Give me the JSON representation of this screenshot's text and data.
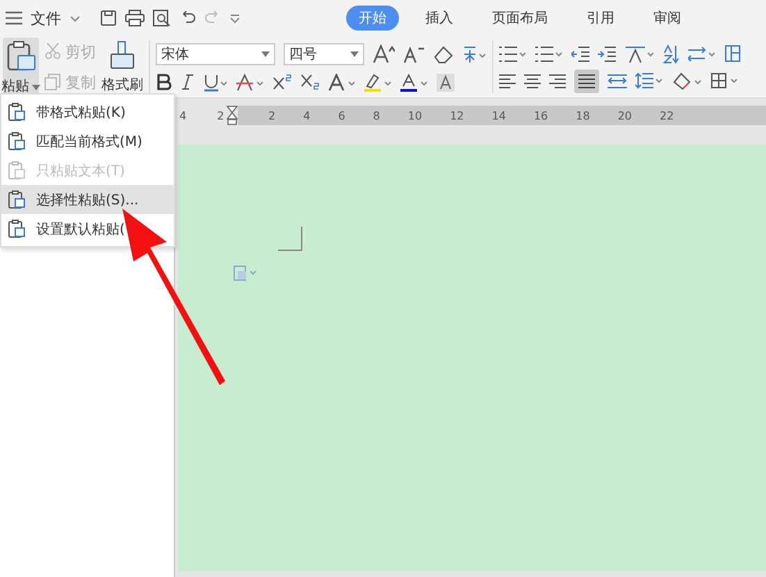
{
  "menu_bar": {
    "file_label": "文件",
    "tabs": [
      {
        "label": "开始",
        "selected": true
      },
      {
        "label": "插入",
        "selected": false
      },
      {
        "label": "页面布局",
        "selected": false
      },
      {
        "label": "引用",
        "selected": false
      },
      {
        "label": "审阅",
        "selected": false
      }
    ]
  },
  "toolbar": {
    "paste_label": "粘贴",
    "cut_label": "剪切",
    "copy_label": "复制",
    "format_painter_label": "格式刷",
    "font_name": "宋体",
    "font_size": "四号"
  },
  "ruler": {
    "labels": [
      "4",
      "2",
      "2",
      "4",
      "6",
      "8",
      "10",
      "12",
      "14",
      "16",
      "18",
      "20",
      "22"
    ]
  },
  "paste_menu": {
    "items": [
      {
        "label": "带格式粘贴(K)",
        "disabled": false,
        "selected": false
      },
      {
        "label": "匹配当前格式(M)",
        "disabled": false,
        "selected": false
      },
      {
        "label": "只粘贴文本(T)",
        "disabled": true,
        "selected": false
      },
      {
        "label": "选择性粘贴(S)...",
        "disabled": false,
        "selected": true
      },
      {
        "label": "设置默认粘贴(",
        "disabled": false,
        "selected": false
      }
    ]
  }
}
